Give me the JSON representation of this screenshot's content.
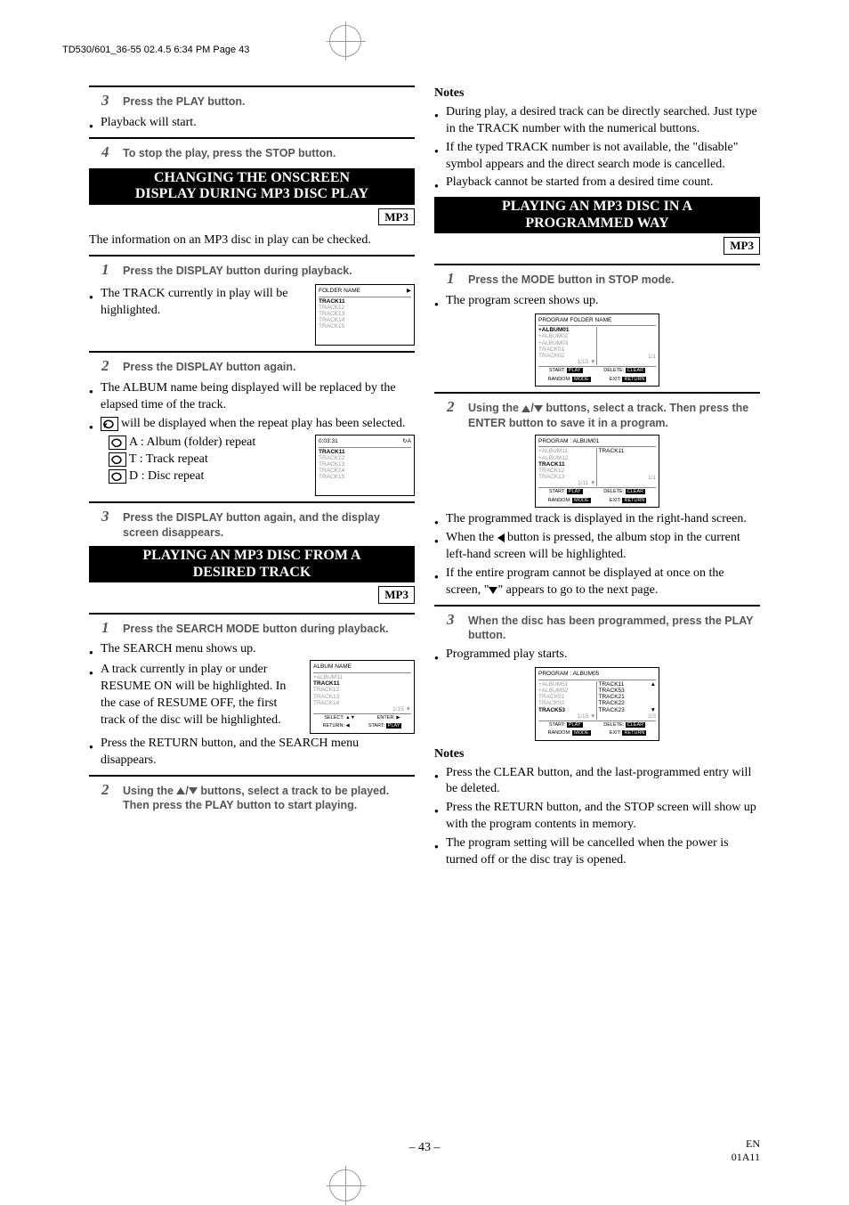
{
  "header_line": "TD530/601_36-55  02.4.5 6:34 PM  Page 43",
  "left": {
    "step3": "Press the PLAY button.",
    "play_start": "Playback will start.",
    "step4": "To stop the play, press the STOP button.",
    "sec1_title1": "CHANGING THE ONSCREEN",
    "sec1_title2": "DISPLAY DURING MP3 DISC PLAY",
    "mp3": "MP3",
    "info_para": "The information on an MP3 disc in play can be checked.",
    "s1": "Press the DISPLAY button during playback.",
    "b1": "The TRACK currently in play will be highlighted.",
    "s2": "Press the DISPLAY button again.",
    "b2": "The ALBUM name being displayed will be replaced by the elapsed time of the track.",
    "b3_pre": "",
    "b3_post": "will be displayed when the repeat play has been selected.",
    "ra": "A : Album (folder) repeat",
    "rt": "T : Track repeat",
    "rd": "D : Disc repeat",
    "s3": "Press the DISPLAY button again, and the display screen disappears.",
    "sec2_title1": "PLAYING AN MP3 DISC FROM A",
    "sec2_title2": "DESIRED TRACK",
    "s2_1": "Press the SEARCH MODE button during playback.",
    "b4": "The SEARCH menu shows up.",
    "b5": "A track currently in play or under RESUME ON will be highlighted. In the case of RESUME OFF, the first track of the disc will be highlighted.",
    "b6": "Press the RETURN button, and the SEARCH menu disappears.",
    "s2_2_a": "Using the ",
    "s2_2_b": " buttons, select a track to be played. Then press the PLAY button to start playing.",
    "dia1_header": "FOLDER NAME",
    "dia1_l1": "TRACK11",
    "dia1_l2": "TRACK12",
    "dia1_l3": "TRACK13",
    "dia1_l4": "TRACK14",
    "dia1_l5": "TRACK15",
    "dia2_header": "0:03:31",
    "dia2_rpt": "A",
    "dia3_header": "ALBUM NAME",
    "dia3_l0": "+ALBUM11",
    "dia3_ct": "1/15",
    "dia3_f1": "SELECT:",
    "dia3_f2": "ENTER:",
    "dia3_f3": "RETURN:",
    "dia3_f4": "START:",
    "dia3_fplay": "PLAY"
  },
  "right": {
    "notes": "Notes",
    "n1": "During play, a desired track can be directly searched. Just type in the TRACK number with the numerical buttons.",
    "n2": "If the typed TRACK number is not available, the \"disable\" symbol appears and the direct search mode is cancelled.",
    "n3": "Playback cannot be started from a desired time count.",
    "sec_title1": "PLAYING AN MP3 DISC IN A",
    "sec_title2": "PROGRAMMED WAY",
    "mp3": "MP3",
    "s1": "Press the MODE button in STOP mode.",
    "b1": "The program screen shows up.",
    "s2_a": "Using the ",
    "s2_b": " buttons, select a track. Then press the ENTER button to save it in a program.",
    "b2": "The programmed track is displayed in the right-hand screen.",
    "b3_a": "When the ",
    "b3_b": " button is pressed, the album stop in the current left-hand screen will be highlighted.",
    "b4_a": "If the entire program cannot be displayed at once on the screen, \"",
    "b4_b": "\" appears to go to the next page.",
    "s3": "When the disc has been programmed, press the PLAY button.",
    "b5": "Programmed play starts.",
    "nn1": "Press the CLEAR button, and the last-programmed entry will be deleted.",
    "nn2": "Press the RETURN button, and the STOP screen will show up with the program contents in memory.",
    "nn3": "The program setting will be cancelled when the power is turned off or the disc tray is opened.",
    "diaA_header": "PROGRAM FOLDER NAME",
    "diaA_l1": "+ALBUM01",
    "diaA_l2": "+ALBUM02",
    "diaA_l3": "+ALBUM03",
    "diaA_l4": "TRACK01",
    "diaA_l5": "TRACK02",
    "diaA_ct": "1/1",
    "dia_f_start": "START:",
    "dia_f_play": "PLAY",
    "dia_f_delete": "DELETE:",
    "dia_f_clear": "CLEAR",
    "dia_f_random": "RANDOM:",
    "dia_f_mode": "MODE",
    "dia_f_exit": "EXIT:",
    "dia_f_return": "RETURN",
    "diaB_header": "PROGRAM : ALBUM01",
    "diaB_l1": "+ALBUM11",
    "diaB_l2": "+ALBUM12",
    "diaB_l3": "TRACK11",
    "diaB_l4": "TRACK12",
    "diaB_l5": "TRACK13",
    "diaB_r1": "TRACK11",
    "diaB_ct": "1/11",
    "diaC_header": "PROGRAM : ALBUM05",
    "diaC_l1": "+ALBUM51",
    "diaC_l2": "+ALBUM52",
    "diaC_l3": "TRACK51",
    "diaC_l4": "TRACK52",
    "diaC_l5": "TRACK53",
    "diaC_r1": "TRACK11",
    "diaC_r2": "TRACK53",
    "diaC_r3": "TRACK21",
    "diaC_r4": "TRACK22",
    "diaC_r5": "TRACK23",
    "diaC_ctl": "1/15",
    "diaC_ctr": "2/3"
  },
  "page_number": "– 43 –",
  "footer_code1": "EN",
  "footer_code2": "01A11"
}
